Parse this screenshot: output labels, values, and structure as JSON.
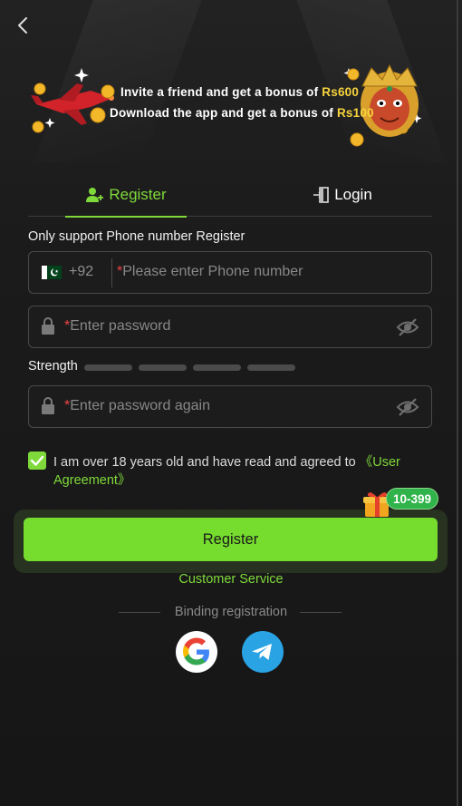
{
  "banner": {
    "line1_prefix": "Invite a friend and get a bonus of",
    "line1_amount": "Rs600",
    "line2_prefix": "Download the app and get a bonus of",
    "line2_amount": "Rs100"
  },
  "tabs": [
    {
      "label": "Register",
      "active": true
    },
    {
      "label": "Login",
      "active": false
    }
  ],
  "form": {
    "support_label": "Only support Phone number Register",
    "country_code": "+92",
    "phone_placeholder": "Please enter Phone number",
    "password_placeholder": "Enter password",
    "password_again_placeholder": "Enter password again",
    "required_mark": "*",
    "strength_label": "Strength",
    "strength_level": 0
  },
  "agreement": {
    "checked": true,
    "text": "I am over 18 years old and have read and agreed to",
    "link": "《User Agreement》"
  },
  "register_button": "Register",
  "bonus_badge": "10-399",
  "customer_service": "Customer Service",
  "binding_label": "Binding registration",
  "social": [
    {
      "icon": "google-icon"
    },
    {
      "icon": "telegram-icon"
    }
  ],
  "colors": {
    "accent": "#7fd93a",
    "button": "#76dc2e",
    "background": "#1a1a1a",
    "required": "#e44444",
    "badge": "#2fb34a"
  }
}
